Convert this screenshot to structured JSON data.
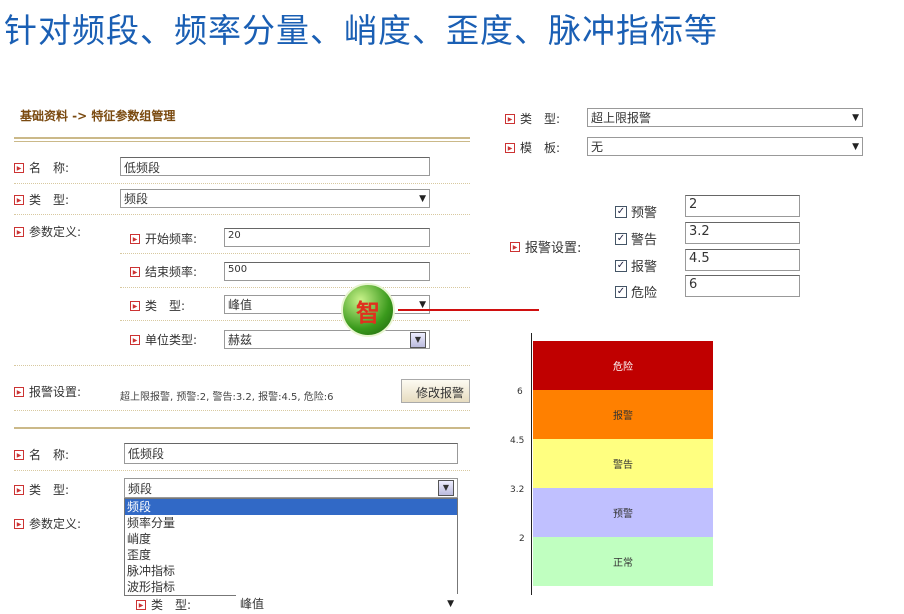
{
  "heading": "针对频段、频率分量、峭度、歪度、脉冲指标等",
  "breadcrumb": "基础资料 -> 特征参数组管理",
  "form1": {
    "name_label": "名　称:",
    "name_value": "低频段",
    "type_label": "类　型:",
    "type_value": "频段",
    "param_label": "参数定义:",
    "start_label": "开始频率:",
    "start_value": "20",
    "end_label": "结束频率:",
    "end_value": "500",
    "subtype_label": "类　型:",
    "subtype_value": "峰值",
    "unit_label": "单位类型:",
    "unit_value": "赫兹",
    "alarm_label": "报警设置:",
    "alarm_value": "超上限报警, 预警:2, 警告:3.2, 报警:4.5, 危险:6",
    "modify_button": "修改报警"
  },
  "form2": {
    "name_label": "名　称:",
    "name_value": "低频段",
    "type_label": "类　型:",
    "type_value": "频段",
    "param_label": "参数定义:",
    "options": [
      "频段",
      "频率分量",
      "峭度",
      "歪度",
      "脉冲指标",
      "波形指标"
    ],
    "subtype_label": "类　型:",
    "subtype_value": "峰值"
  },
  "right": {
    "type_label": "类　型:",
    "type_value": "超上限报警",
    "template_label": "模　板:",
    "template_value": "无",
    "alarm_label": "报警设置:",
    "levels": [
      {
        "label": "预警",
        "value": "2"
      },
      {
        "label": "警告",
        "value": "3.2"
      },
      {
        "label": "报警",
        "value": "4.5"
      },
      {
        "label": "危险",
        "value": "6"
      }
    ]
  },
  "badge": "智",
  "chart_data": {
    "type": "area",
    "bands": [
      {
        "name": "危险",
        "color": "#c00000"
      },
      {
        "name": "报警",
        "color": "#ff8000"
      },
      {
        "name": "警告",
        "color": "#ffff80"
      },
      {
        "name": "预警",
        "color": "#c0c0ff"
      },
      {
        "name": "正常",
        "color": "#c0ffc0"
      }
    ],
    "y_ticks": [
      "6",
      "4.5",
      "3.2",
      "2"
    ]
  }
}
